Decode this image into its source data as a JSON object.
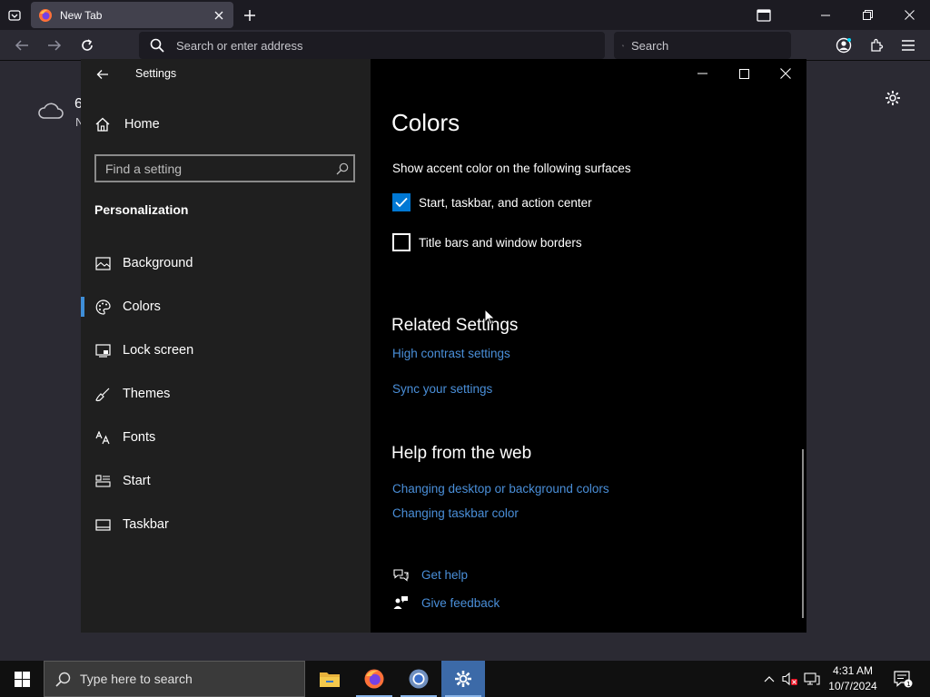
{
  "browser": {
    "tab_title": "New Tab",
    "url_placeholder": "Search or enter address",
    "search_placeholder": "Search"
  },
  "page_peek": {
    "line1": "6",
    "line2": "N"
  },
  "settings": {
    "title": "Settings",
    "home_label": "Home",
    "find_placeholder": "Find a setting",
    "section": "Personalization",
    "nav_items": [
      {
        "label": "Background"
      },
      {
        "label": "Colors"
      },
      {
        "label": "Lock screen"
      },
      {
        "label": "Themes"
      },
      {
        "label": "Fonts"
      },
      {
        "label": "Start"
      },
      {
        "label": "Taskbar"
      }
    ],
    "active_item": "Colors",
    "main": {
      "heading": "Colors",
      "accent_subhead": "Show accent color on the following surfaces",
      "checkbox_start": {
        "label": "Start, taskbar, and action center",
        "checked": true
      },
      "checkbox_title": {
        "label": "Title bars and window borders",
        "checked": false
      },
      "related_heading": "Related Settings",
      "related_links": [
        "High contrast settings",
        "Sync your settings"
      ],
      "help_heading": "Help from the web",
      "help_links": [
        "Changing desktop or background colors",
        "Changing taskbar color"
      ],
      "get_help": "Get help",
      "give_feedback": "Give feedback"
    }
  },
  "taskbar": {
    "search_placeholder": "Type here to search",
    "time": "4:31 AM",
    "date": "10/7/2024",
    "notification_count": "1"
  },
  "colors": {
    "accent": "#0078d4",
    "link": "#4a8fd9",
    "active_indicator": "#3e8ed8"
  }
}
